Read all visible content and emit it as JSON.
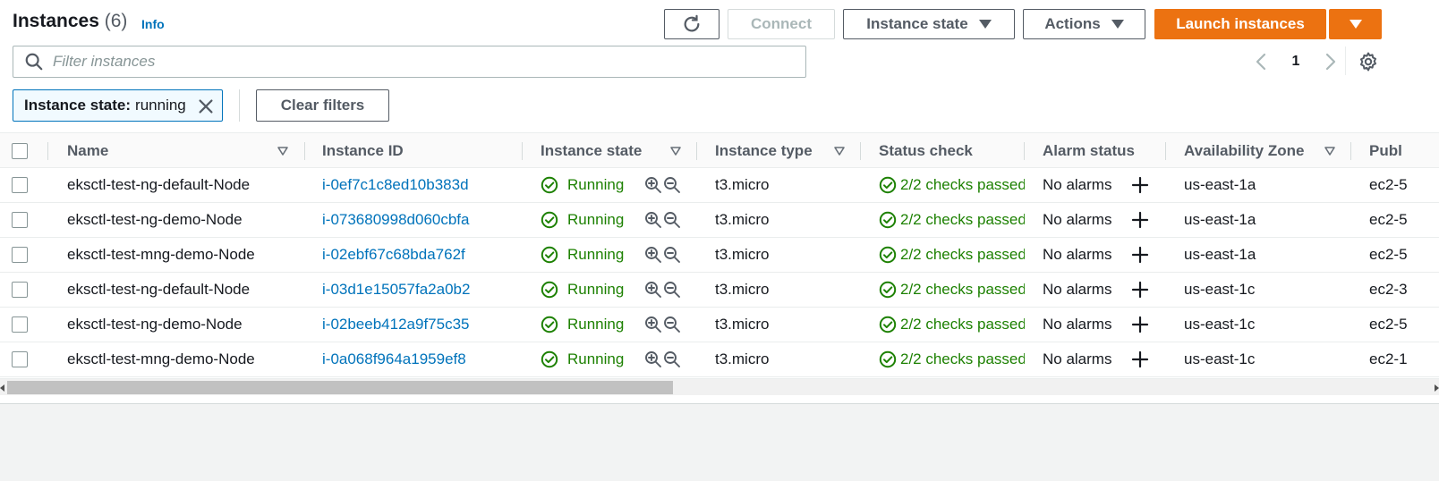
{
  "header": {
    "title": "Instances",
    "count": "(6)",
    "info_link": "Info"
  },
  "toolbar": {
    "connect_label": "Connect",
    "instance_state_label": "Instance state",
    "actions_label": "Actions",
    "launch_label": "Launch instances"
  },
  "search": {
    "placeholder": "Filter instances",
    "value": ""
  },
  "pagination": {
    "current_page": "1"
  },
  "filters": {
    "token_key": "Instance state:",
    "token_value": "running",
    "clear_label": "Clear filters"
  },
  "table": {
    "columns": [
      "Name",
      "Instance ID",
      "Instance state",
      "Instance type",
      "Status check",
      "Alarm status",
      "Availability Zone",
      "Publ"
    ],
    "rows": [
      {
        "name": "eksctl-test-ng-default-Node",
        "instance_id": "i-0ef7c1c8ed10b383d",
        "state": "Running",
        "type": "t3.micro",
        "status_check": "2/2 checks passed",
        "alarm": "No alarms",
        "az": "us-east-1a",
        "public_dns": "ec2-5"
      },
      {
        "name": "eksctl-test-ng-demo-Node",
        "instance_id": "i-073680998d060cbfa",
        "state": "Running",
        "type": "t3.micro",
        "status_check": "2/2 checks passed",
        "alarm": "No alarms",
        "az": "us-east-1a",
        "public_dns": "ec2-5"
      },
      {
        "name": "eksctl-test-mng-demo-Node",
        "instance_id": "i-02ebf67c68bda762f",
        "state": "Running",
        "type": "t3.micro",
        "status_check": "2/2 checks passed",
        "alarm": "No alarms",
        "az": "us-east-1a",
        "public_dns": "ec2-5"
      },
      {
        "name": "eksctl-test-ng-default-Node",
        "instance_id": "i-03d1e15057fa2a0b2",
        "state": "Running",
        "type": "t3.micro",
        "status_check": "2/2 checks passed",
        "alarm": "No alarms",
        "az": "us-east-1c",
        "public_dns": "ec2-3"
      },
      {
        "name": "eksctl-test-ng-demo-Node",
        "instance_id": "i-02beeb412a9f75c35",
        "state": "Running",
        "type": "t3.micro",
        "status_check": "2/2 checks passed",
        "alarm": "No alarms",
        "az": "us-east-1c",
        "public_dns": "ec2-5"
      },
      {
        "name": "eksctl-test-mng-demo-Node",
        "instance_id": "i-0a068f964a1959ef8",
        "state": "Running",
        "type": "t3.micro",
        "status_check": "2/2 checks passed",
        "alarm": "No alarms",
        "az": "us-east-1c",
        "public_dns": "ec2-1"
      }
    ]
  },
  "icons": {
    "refresh": "refresh-icon",
    "search": "search-icon",
    "dismiss": "close-icon",
    "settings": "gear-icon",
    "status_ok": "check-circle-icon",
    "zoom_in": "zoom-in-icon",
    "zoom_out": "zoom-out-icon",
    "add_alarm": "plus-icon"
  },
  "colors": {
    "primary_orange": "#ec7211",
    "link_blue": "#0073bb",
    "success_green": "#1d8102",
    "text_dark": "#16191f",
    "text_secondary": "#545b64"
  }
}
